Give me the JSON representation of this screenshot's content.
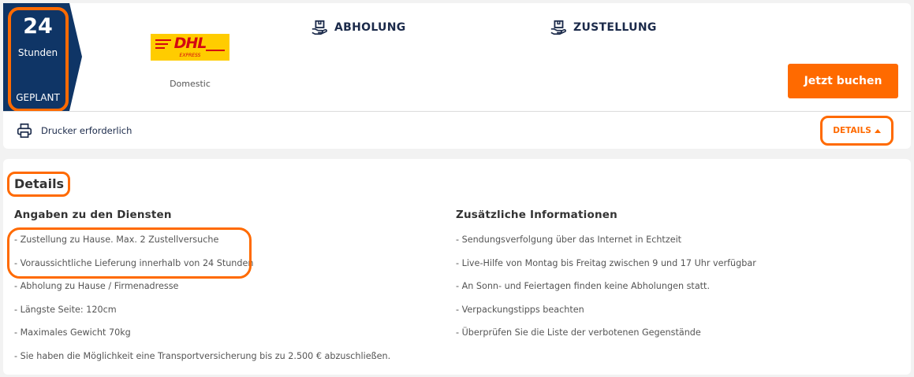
{
  "badge": {
    "number": "24",
    "unit": "Stunden",
    "status": "GEPLANT",
    "color": "#0f3566"
  },
  "carrier": {
    "logo_text": "DHL",
    "logo_subtext": "EXPRESS",
    "service_type": "Domestic"
  },
  "services": {
    "pickup_label": "ABHOLUNG",
    "delivery_label": "ZUSTELLUNG"
  },
  "actions": {
    "book_label": "Jetzt buchen",
    "details_label": "DETAILS"
  },
  "printer": {
    "label": "Drucker erforderlich"
  },
  "details": {
    "title": "Details",
    "left_heading": "Angaben zu den Diensten",
    "left_items": [
      "- Zustellung zu Hause. Max. 2 Zustellversuche",
      "- Voraussichtliche Lieferung innerhalb von 24 Stunden",
      "- Abholung zu Hause / Firmenadresse",
      "- Längste Seite: 120cm",
      "- Maximales Gewicht 70kg",
      "- Sie haben die Möglichkeit eine Transportversicherung bis zu 2.500 € abzuschließen."
    ],
    "right_heading": "Zusätzliche Informationen",
    "right_items": [
      "- Sendungsverfolgung über das Internet in Echtzeit",
      "- Live-Hilfe von Montag bis Freitag zwischen 9 und 17 Uhr verfügbar",
      "- An Sonn- und Feiertagen finden keine Abholungen statt.",
      "- Verpackungstipps beachten",
      "- Überprüfen Sie die Liste der verbotenen Gegenstände"
    ]
  },
  "colors": {
    "accent": "#ff6a00",
    "navy": "#0f3566",
    "dhl_yellow": "#ffcc00",
    "dhl_red": "#d40511"
  }
}
